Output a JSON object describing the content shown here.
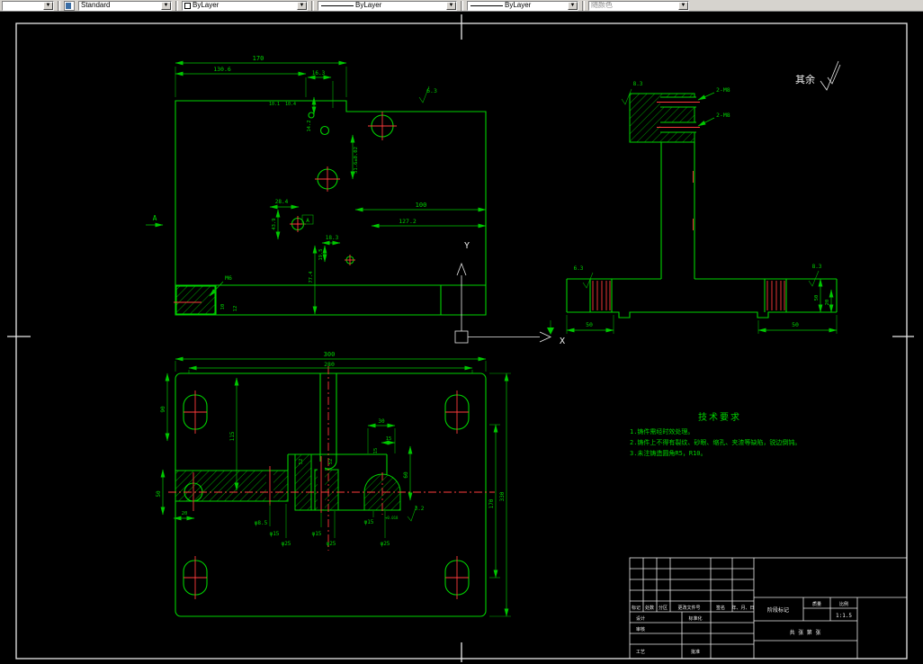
{
  "toolbar": {
    "partial_label": "",
    "style_label": "Standard",
    "color_label": "ByLayer",
    "linetype_label": "ByLayer",
    "lineweight_label": "ByLayer",
    "plotstyle_label": "随颜色",
    "arrow_glyph": "▼"
  },
  "annotations": {
    "surplus_label": "其余",
    "ucs_x": "X",
    "ucs_y": "Y"
  },
  "front_view": {
    "dims": {
      "w170": "170",
      "w130_6": "130.6",
      "w16_3": "16.3",
      "d10_1": "10.1",
      "d10_4": "10.4",
      "d14_2": "14.2",
      "sf6_3": "6.3",
      "d51_6": "51.6±0.02",
      "d28_4": "28.4",
      "d43_9": "43.9",
      "d100": "100",
      "d127_2": "127.2",
      "d18_3": "18.3",
      "d19_5": "19.5",
      "d77_4": "77.4",
      "m6": "M6",
      "d10": "10",
      "d12": "12",
      "section_a": "A",
      "datum_a": "A"
    }
  },
  "side_view": {
    "dims": {
      "m8_top": "2-M8",
      "m8_bottom": "2-M8",
      "sf8_3_left": "8.3",
      "sf8_3_right": "8.3",
      "sf6_3": "6.3",
      "d50_left": "50",
      "d50_right": "50",
      "d50_vert": "50",
      "d20_vert": "20"
    }
  },
  "top_view": {
    "dims": {
      "d300": "300",
      "d280": "280",
      "d90": "90",
      "d115": "115",
      "d50": "50",
      "d20": "20",
      "d30": "30",
      "d15a": "15",
      "d15b": "15",
      "d52a": "52",
      "d52b": "52",
      "d60": "60",
      "d170": "170",
      "d330": "330",
      "sf3_2": "3.2",
      "h8_5": "φ8.5",
      "h15a": "φ15",
      "h25a": "φ25",
      "h15b": "φ15",
      "h25b": "φ25",
      "h15c": "φ15",
      "tol": "+0.018",
      "h25c": "φ25"
    }
  },
  "tech_requirements": {
    "title": "技术要求",
    "item1": "1.铸件需经时效处理。",
    "item2": "2.铸件上不得有裂纹、砂眼、缩孔、夹渣等缺陷，锐边倒钝。",
    "item3": "3.未注铸造圆角R5，R10。"
  },
  "title_block": {
    "h_mark": "标记",
    "h_count": "处数",
    "h_zone": "分区",
    "h_docno": "更改文件号",
    "h_sign": "签名",
    "h_date": "年、月、日",
    "row_design": "设计",
    "row_standard": "标准化",
    "row_check": "审核",
    "row_process": "工艺",
    "row_approve": "批准",
    "stage_label": "阶段标记",
    "mass_label": "质量",
    "scale_label": "比例",
    "scale_value": "1:1.5",
    "sheets_label": "共 张 第 张"
  }
}
